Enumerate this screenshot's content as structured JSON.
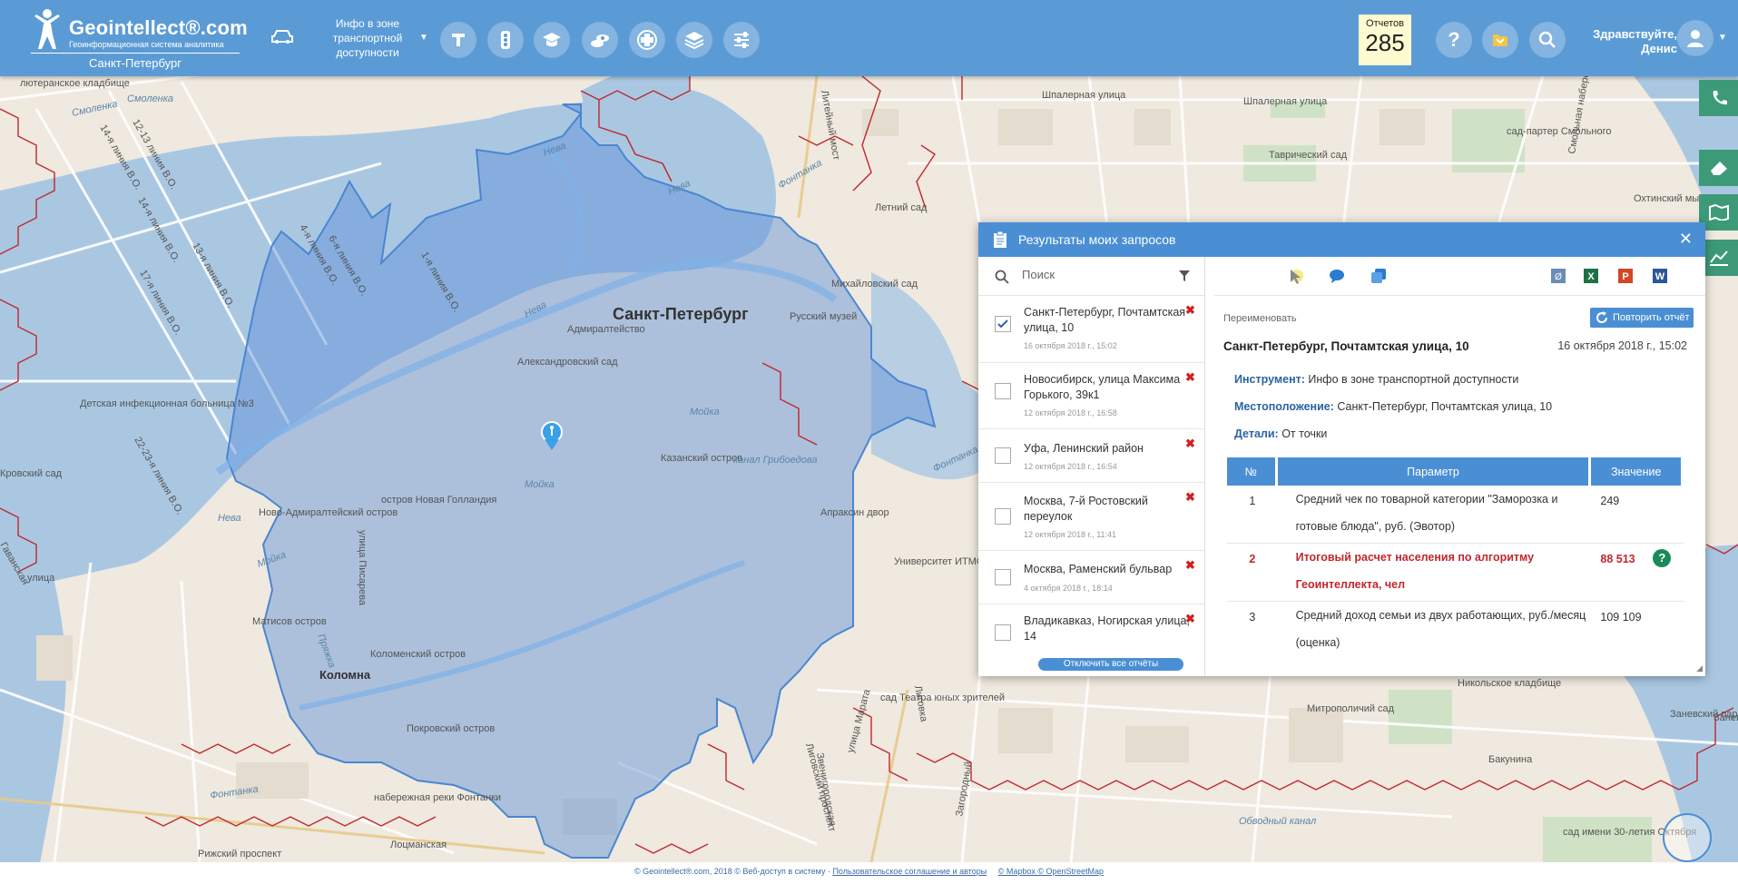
{
  "header": {
    "logo_name": "Geointellect®.com",
    "logo_subtitle": "Геоинформационная система аналитика",
    "city": "Санкт-Петербург",
    "tool_label": "Инфо в зоне транспортной доступности",
    "reports_label": "Отчетов",
    "reports_count": "285",
    "greeting_line1": "Здравствуйте,",
    "greeting_line2": "Денис",
    "icons": [
      "car-icon",
      "text-tool-icon",
      "traffic-light-icon",
      "education-icon",
      "money-icon",
      "medical-icon",
      "layers-icon",
      "sliders-icon",
      "help-icon",
      "folder-icon",
      "search-icon",
      "user-icon"
    ]
  },
  "map": {
    "city_label": "Санкт-Петербург",
    "labels": [
      "лютеранское кладбище",
      "Смоленка",
      "Смоленка",
      "Нева",
      "Нева",
      "Нева",
      "Нева",
      "Фонтанка",
      "Мойка",
      "Мойка",
      "Мойка",
      "Фонтанка",
      "Фонтанка",
      "Шпалерная улица",
      "Шпалерная улица",
      "Литейный мост",
      "Таврический сад",
      "Летний сад",
      "сад-партер Смольного",
      "Смольная набережная",
      "Охтинский мыс",
      "Михайловский сад",
      "Русский музей",
      "Адмиралтейство",
      "Александровский сад",
      "Казанский остров",
      "канал Грибоедова",
      "Апраксин двор",
      "Университет ИТМО",
      "остров Новая Голландия",
      "Ново-Адмиралтейский остров",
      "Матисов остров",
      "Коломна",
      "Коломенский остров",
      "Покровский остров",
      "Детская инфекционная больница №3",
      "улица Писарева",
      "Пряжка",
      "набережная реки Фонтанки",
      "Рижский проспект",
      "Лоцманская",
      "Обводный канал",
      "Митрополичий сад",
      "Никольское кладбище",
      "Заневский парк",
      "сад имени 30-летия Октября",
      "сад Театра юных зрителей",
      "Звенигородская",
      "улица Марата",
      "Лиговский проспект",
      "Загородный",
      "Бакунина",
      "Кровский сад",
      "14-я линия В.О.",
      "12-13 линия В.О.",
      "14-я линия В.О.",
      "4-я линия В.О.",
      "1-я линия В.О.",
      "6-я линия В.О.",
      "17-я линия В.О.",
      "22-23-я линия В.О.",
      "13-я линия В.О.",
      "Гаванская",
      "улица",
      "Лиговка",
      "Заневский"
    ]
  },
  "panel": {
    "title": "Результаты моих запросов",
    "search_placeholder": "Поиск",
    "requests": [
      {
        "title": "Санкт-Петербург, Почтамтская улица, 10",
        "date": "16 октября 2018 г., 15:02",
        "checked": true
      },
      {
        "title": "Новосибирск, улица Максима Горького, 39к1",
        "date": "12 октября 2018 г., 16:58",
        "checked": false
      },
      {
        "title": "Уфа, Ленинский район",
        "date": "12 октября 2018 г., 16:54",
        "checked": false
      },
      {
        "title": "Москва, 7-й Ростовский переулок",
        "date": "12 октября 2018 г., 11:41",
        "checked": false
      },
      {
        "title": "Москва, Раменский бульвар",
        "date": "4 октября 2018 г., 18:14",
        "checked": false
      },
      {
        "title": "Владикавказ, Ногирская улица, 14",
        "date": "",
        "checked": false
      }
    ],
    "disable_all": "Отключить все отчёты",
    "rename": "Переименовать",
    "repeat": "Повторить отчёт",
    "report_title": "Санкт-Петербург, Почтамтская улица, 10",
    "report_date": "16 октября 2018 г., 15:02",
    "instrument_label": "Инструмент:",
    "instrument_value": "Инфо в зоне транспортной доступности",
    "location_label": "Местоположение:",
    "location_value": "Санкт-Петербург, Почтамтская улица, 10",
    "details_label": "Детали:",
    "details_value": "От точки",
    "table_headers": [
      "№",
      "Параметр",
      "Значение"
    ],
    "rows": [
      {
        "n": "1",
        "param": "Средний чек по товарной категории \"Заморозка и готовые блюда\", руб. (Эвотор)",
        "value": "249"
      },
      {
        "n": "2",
        "param": "Итоговый расчет населения по алгоритму Геоинтеллекта, чел",
        "value": "88 513"
      },
      {
        "n": "3",
        "param": "Средний доход семьи из двух работающих, руб./месяц (оценка)",
        "value": "109 109"
      }
    ]
  },
  "footer": {
    "copyright": "© Geointellect®.com, 2018 © Веб-доступ в систему · ",
    "terms_link": "Пользовательское соглашение и авторы",
    "map_link": "© Mapbox © OpenStreetMap"
  },
  "colors": {
    "header": "#5b9bd5",
    "panel_head": "#4a8fd4",
    "isochrone": "#5b8fd6",
    "highlight": "#c0272d",
    "side_tab": "#3d9a78"
  }
}
